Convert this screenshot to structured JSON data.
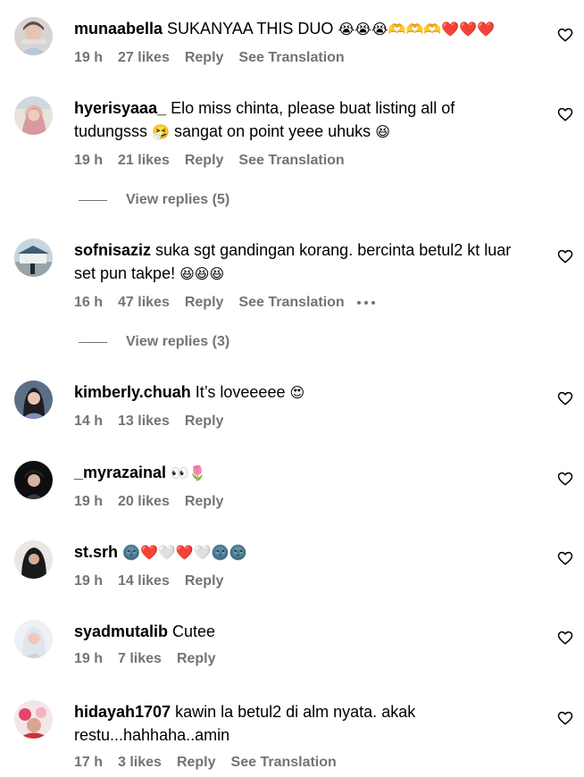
{
  "comments": [
    {
      "username": "munaabella",
      "text": "SUKANYAA THIS DUO",
      "emojis": "😭😭😭🫶🫶🫶❤️❤️❤️",
      "time": "19 h",
      "likes": "27 likes",
      "reply": "Reply",
      "translation": "See Translation"
    },
    {
      "username": "hyerisyaaa_",
      "text": "Elo miss chinta, please buat listing all of tudungsss",
      "emojis_mid": "🤧",
      "text2": "sangat on point yeee uhuks",
      "emojis": "😆",
      "time": "19 h",
      "likes": "21 likes",
      "reply": "Reply",
      "translation": "See Translation",
      "view_replies": "View replies (5)"
    },
    {
      "username": "sofnisaziz",
      "text": "suka sgt gandingan korang. bercinta betul2 kt luar set pun takpe!",
      "emojis": "😆😆😆",
      "time": "16 h",
      "likes": "47 likes",
      "reply": "Reply",
      "translation": "See Translation",
      "more_icon": "more-options-icon",
      "view_replies": "View replies (3)"
    },
    {
      "username": "kimberly.chuah",
      "text": "It’s loveeeee",
      "emojis": "😍",
      "time": "14 h",
      "likes": "13 likes",
      "reply": "Reply"
    },
    {
      "username": "_myrazainal",
      "text": "",
      "emojis": "👀🌷",
      "time": "19 h",
      "likes": "20 likes",
      "reply": "Reply"
    },
    {
      "username": "st.srh",
      "text": "",
      "emojis": "🌚❤️🤍❤️🤍🌚🌚",
      "time": "19 h",
      "likes": "14 likes",
      "reply": "Reply"
    },
    {
      "username": "syadmutalib",
      "text": "Cutee",
      "emojis": "",
      "time": "19 h",
      "likes": "7 likes",
      "reply": "Reply"
    },
    {
      "username": "hidayah1707",
      "text": "kawin la betul2 di alm nyata. akak restu...hahhaha..amin",
      "emojis": "",
      "time": "17 h",
      "likes": "3 likes",
      "reply": "Reply",
      "translation": "See Translation"
    }
  ],
  "colors": {
    "text": "#000000",
    "meta": "#737373",
    "background": "#ffffff"
  }
}
